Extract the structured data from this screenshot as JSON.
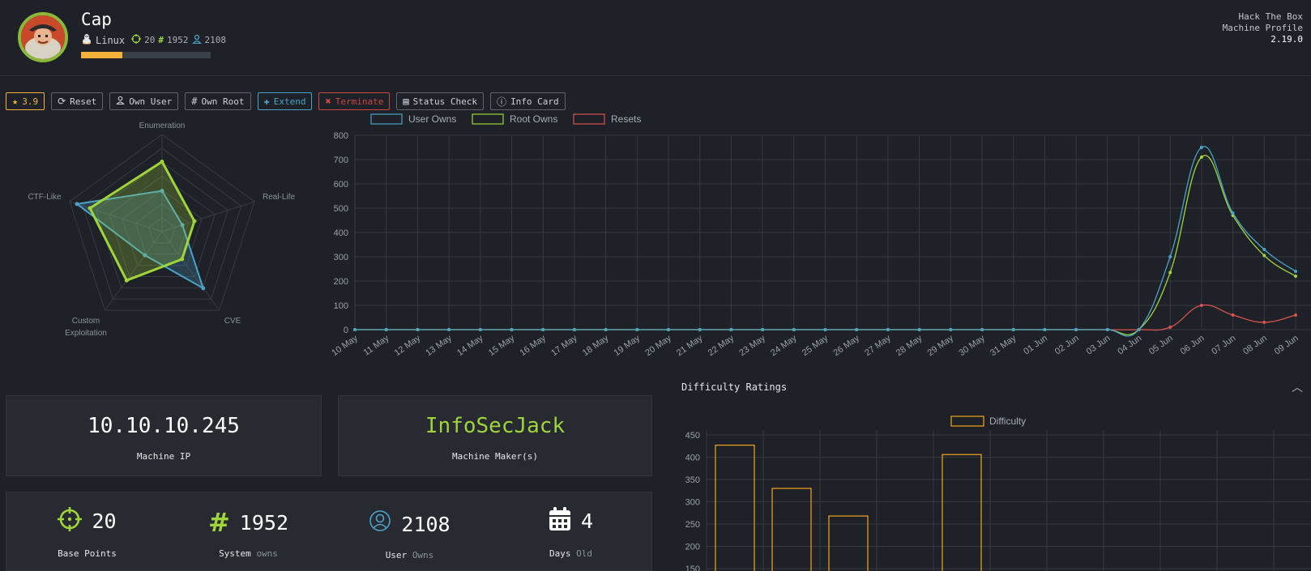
{
  "machine": {
    "name": "Cap",
    "os": "Linux",
    "points": "20",
    "system_owns": "1952",
    "user_owns": "2108",
    "progress_fraction": 0.32
  },
  "brand": {
    "line1": "Hack The Box",
    "line2": "Machine Profile",
    "version": "2.19.0"
  },
  "toolbar": {
    "rating": "3.9",
    "reset": "Reset",
    "own_user": "Own User",
    "own_root": "Own Root",
    "extend": "Extend",
    "terminate": "Terminate",
    "status_check": "Status Check",
    "info_card": "Info Card"
  },
  "radar": {
    "axes": [
      "Enumeration",
      "Real-Life",
      "CVE",
      "Custom Exploitation",
      "CTF-Like"
    ],
    "series": [
      {
        "values": [
          0.42,
          0.22,
          0.72,
          0.3,
          0.92
        ],
        "color": "#4aa3c7"
      },
      {
        "values": [
          0.72,
          0.35,
          0.35,
          0.62,
          0.78
        ],
        "color": "#9fd43a"
      }
    ]
  },
  "chart_data": [
    {
      "type": "line",
      "x": [
        "10 May",
        "11 May",
        "12 May",
        "13 May",
        "14 May",
        "15 May",
        "16 May",
        "17 May",
        "18 May",
        "19 May",
        "20 May",
        "21 May",
        "22 May",
        "23 May",
        "24 May",
        "25 May",
        "26 May",
        "27 May",
        "28 May",
        "29 May",
        "30 May",
        "31 May",
        "01 Jun",
        "02 Jun",
        "03 Jun",
        "04 Jun",
        "05 Jun",
        "06 Jun",
        "07 Jun",
        "08 Jun",
        "09 Jun"
      ],
      "series": [
        {
          "name": "User Owns",
          "color": "#4aa3c7",
          "values": [
            0,
            0,
            0,
            0,
            0,
            0,
            0,
            0,
            0,
            0,
            0,
            0,
            0,
            0,
            0,
            0,
            0,
            0,
            0,
            0,
            0,
            0,
            0,
            0,
            0,
            0,
            300,
            750,
            480,
            330,
            240
          ]
        },
        {
          "name": "Root Owns",
          "color": "#9fd43a",
          "values": [
            0,
            0,
            0,
            0,
            0,
            0,
            0,
            0,
            0,
            0,
            0,
            0,
            0,
            0,
            0,
            0,
            0,
            0,
            0,
            0,
            0,
            0,
            0,
            0,
            0,
            0,
            235,
            710,
            470,
            305,
            220
          ]
        },
        {
          "name": "Resets",
          "color": "#d9534f",
          "values": [
            0,
            0,
            0,
            0,
            0,
            0,
            0,
            0,
            0,
            0,
            0,
            0,
            0,
            0,
            0,
            0,
            0,
            0,
            0,
            0,
            0,
            0,
            0,
            0,
            0,
            0,
            10,
            100,
            60,
            30,
            60
          ]
        }
      ],
      "ylim": [
        0,
        800
      ],
      "yticks": [
        0,
        100,
        200,
        300,
        400,
        500,
        600,
        700,
        800
      ],
      "grid": true,
      "legend": "top-center"
    },
    {
      "type": "bar",
      "title": "Difficulty Ratings",
      "series": [
        {
          "name": "Difficulty",
          "color": "#f3a522",
          "values": [
            427,
            330,
            268,
            0,
            406,
            0,
            0,
            0,
            0,
            0
          ]
        }
      ],
      "ylim": [
        150,
        450
      ],
      "yticks": [
        150,
        200,
        250,
        300,
        350,
        400,
        450
      ],
      "grid": true,
      "legend": "top-center"
    }
  ],
  "cards": {
    "ip": {
      "value": "10.10.10.245",
      "label": "Machine IP"
    },
    "maker": {
      "value": "InfoSecJack",
      "label": "Machine Maker(s)"
    }
  },
  "stats": [
    {
      "value": "20",
      "label": "Base Points",
      "suffix": "",
      "icon": "crosshair-icon",
      "color": "#9fd43a"
    },
    {
      "value": "1952",
      "label": "System",
      "suffix": "owns",
      "icon": "hash-icon",
      "color": "#9fd43a"
    },
    {
      "value": "2108",
      "label": "User",
      "suffix": "Owns",
      "icon": "user-icon",
      "color": "#4aa3c7"
    },
    {
      "value": "4",
      "label": "Days",
      "suffix": "Old",
      "icon": "calendar-icon",
      "color": "#ffffff"
    }
  ],
  "difficulty": {
    "title": "Difficulty Ratings"
  }
}
